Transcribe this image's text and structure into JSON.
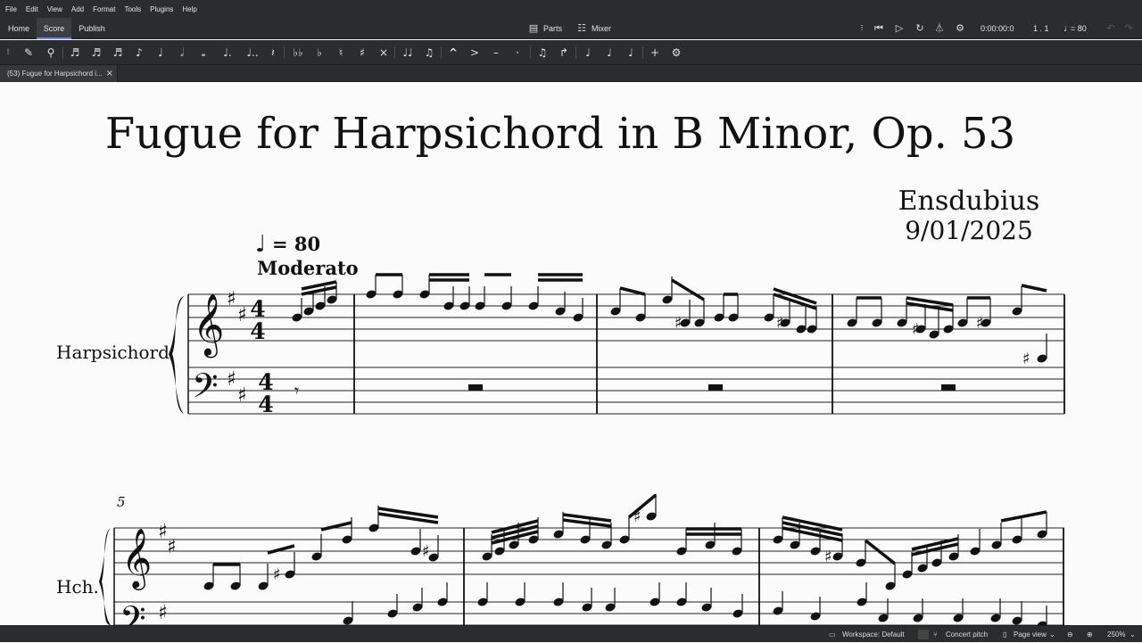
{
  "menu": [
    "File",
    "Edit",
    "View",
    "Add",
    "Format",
    "Tools",
    "Plugins",
    "Help"
  ],
  "tabs": {
    "home": "Home",
    "score": "Score",
    "publish": "Publish"
  },
  "top_controls": {
    "parts": "Parts",
    "mixer": "Mixer",
    "time": "0:00:00:0",
    "position": "1 . 1",
    "tempo": "= 80"
  },
  "doc_tab": {
    "label": "(53) Fugue for Harpsichord i..."
  },
  "score": {
    "title": "Fugue for Harpsichord in B Minor, Op. 53",
    "composer": "Ensdubius",
    "date": "9/01/2025",
    "tempo_number": "= 80",
    "tempo_text": "Moderato",
    "instrument_full": "Harpsichord",
    "instrument_short": "Hch.",
    "measure_number": "5",
    "time_sig_top": "4",
    "time_sig_bottom": "4"
  },
  "status": {
    "workspace": "Workspace: Default",
    "concert_pitch": "Concert pitch",
    "view": "Page view",
    "zoom": "250%"
  },
  "colors": {
    "chrome": "#2b2c2e",
    "accent": "#6f7cff",
    "paper": "#fbfbfb",
    "ink": "#111111"
  }
}
